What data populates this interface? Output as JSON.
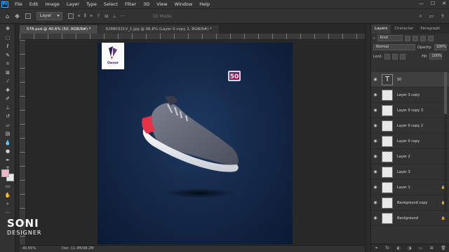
{
  "menu": [
    "File",
    "Edit",
    "Image",
    "Layer",
    "Type",
    "Select",
    "Filter",
    "3D",
    "View",
    "Window",
    "Help"
  ],
  "app_logo": "Ps",
  "window_controls": [
    "—",
    "☐",
    "✕"
  ],
  "options": {
    "auto_select_value": "Layer",
    "mode_3d": "3D Mode:"
  },
  "tabs": [
    {
      "label": "578.psd @ 40.6% (50, RGB/8#) *",
      "active": true
    },
    {
      "label": "92880331V_1.jpg @ 96.8% (Layer 0 copy 2, RGB/8#) *",
      "active": false
    }
  ],
  "panel_tabs": [
    "Layers",
    "Character",
    "Paragraph"
  ],
  "layers_panel": {
    "filter_kind": "Kind",
    "blend_mode": "Normal",
    "opacity_label": "Opacity:",
    "opacity_value": "100%",
    "lock_label": "Lock:",
    "fill_label": "Fill:",
    "fill_value": "100%"
  },
  "layers": [
    {
      "name": "50",
      "type": "text",
      "selected": true
    },
    {
      "name": "Layer 3 copy",
      "type": "pixel"
    },
    {
      "name": "Layer 0 copy 3",
      "type": "pixel"
    },
    {
      "name": "Layer 0 copy 2",
      "type": "pixel"
    },
    {
      "name": "Layer 0 copy",
      "type": "pixel"
    },
    {
      "name": "Layer 2",
      "type": "pixel"
    },
    {
      "name": "Layer 3",
      "type": "pixel"
    },
    {
      "name": "Layer 1",
      "type": "pixel",
      "locked": true
    },
    {
      "name": "Background copy",
      "type": "pixel",
      "locked": true
    },
    {
      "name": "Background",
      "type": "pixel",
      "locked": true,
      "italic": true
    }
  ],
  "status": {
    "zoom": "40.65%",
    "doc": "Doc: 11.4M/98.2M"
  },
  "watermark": {
    "line1": "SONI",
    "line2": "DESIGNER"
  },
  "canvas": {
    "brand_text": "Qwear",
    "sticker_text": "50"
  },
  "colors": {
    "accent": "#31a8ff",
    "canvas_bg": "#15294a",
    "shoe_accent": "#e8324a",
    "foreground": "#f3b4c8",
    "background": "#e8e8e8"
  },
  "tools": [
    "move",
    "marquee",
    "lasso",
    "quick-select",
    "crop",
    "frame",
    "eyedropper",
    "healing",
    "brush",
    "stamp",
    "history-brush",
    "eraser",
    "gradient",
    "blur",
    "dodge",
    "pen",
    "type",
    "path-select",
    "rectangle",
    "hand",
    "zoom",
    "more"
  ]
}
